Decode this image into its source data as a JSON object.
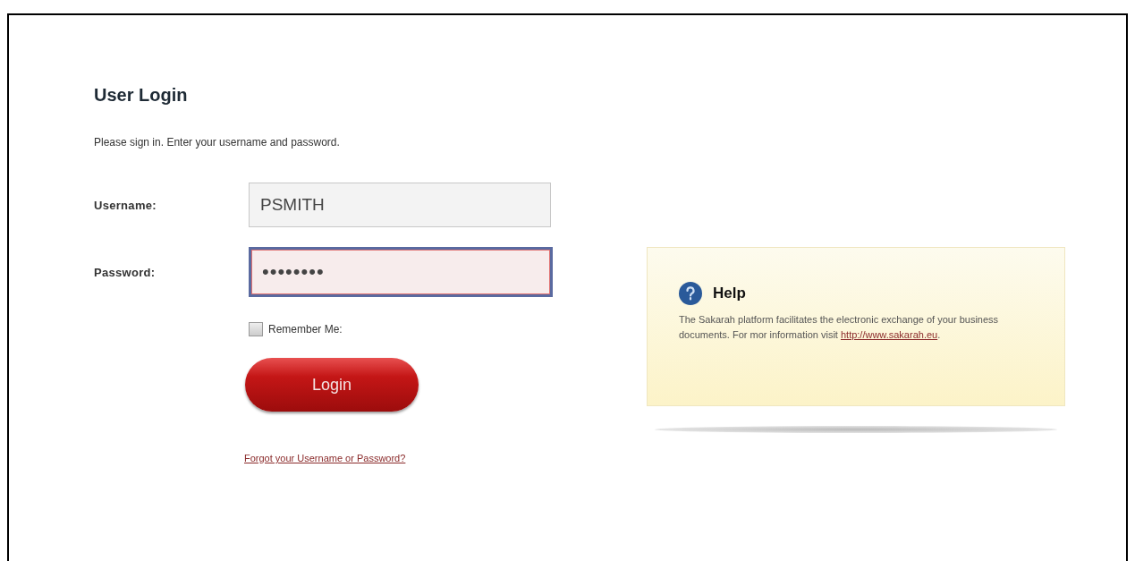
{
  "title": "User Login",
  "instruction": "Please sign in. Enter your username and password.",
  "fields": [
    {
      "label": "Username:",
      "value": "PSMITH",
      "focused": false
    },
    {
      "label": "Password:",
      "value": "••••••••",
      "focused": true
    }
  ],
  "remember_me": {
    "label": "Remember Me:",
    "checked": false
  },
  "login_button": "Login",
  "forgot_link": "Forgot your Username or Password?",
  "help": {
    "title": "Help",
    "text": "The Sakarah platform facilitates the electronic exchange of your business documents. For mor information visit",
    "link": "http://www.sakarah.eu",
    "suffix": "."
  }
}
